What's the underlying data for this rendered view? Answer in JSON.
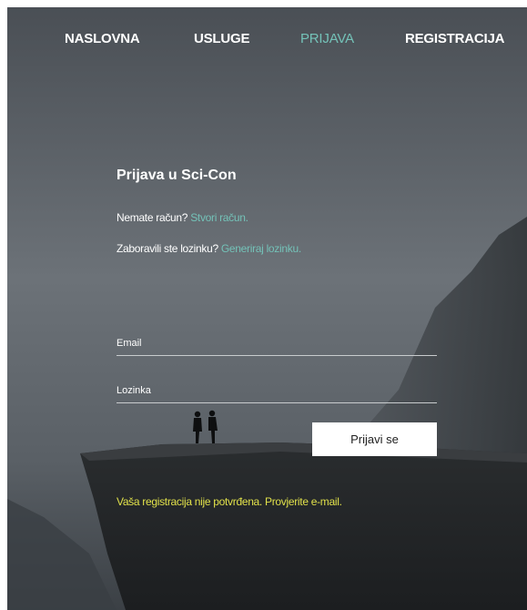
{
  "nav": {
    "items": [
      {
        "label": "NASLOVNA",
        "active": false
      },
      {
        "label": "USLUGE",
        "active": false
      },
      {
        "label": "PRIJAVA",
        "active": true
      },
      {
        "label": "REGISTRACIJA",
        "active": false
      }
    ]
  },
  "login": {
    "title": "Prijava u Sci-Con",
    "no_account_text": "Nemate račun?",
    "create_account_link": "Stvori račun.",
    "forgot_text": "Zaboravili ste lozinku?",
    "generate_link": "Generiraj lozinku.",
    "email_placeholder": "Email",
    "password_placeholder": "Lozinka",
    "submit_label": "Prijavi se",
    "status_message": "Vaša registracija nije potvrđena. Provjerite e-mail."
  },
  "colors": {
    "accent": "#74c2b8",
    "warning_text": "#e0e04a",
    "nav_text": "#ffffff"
  }
}
